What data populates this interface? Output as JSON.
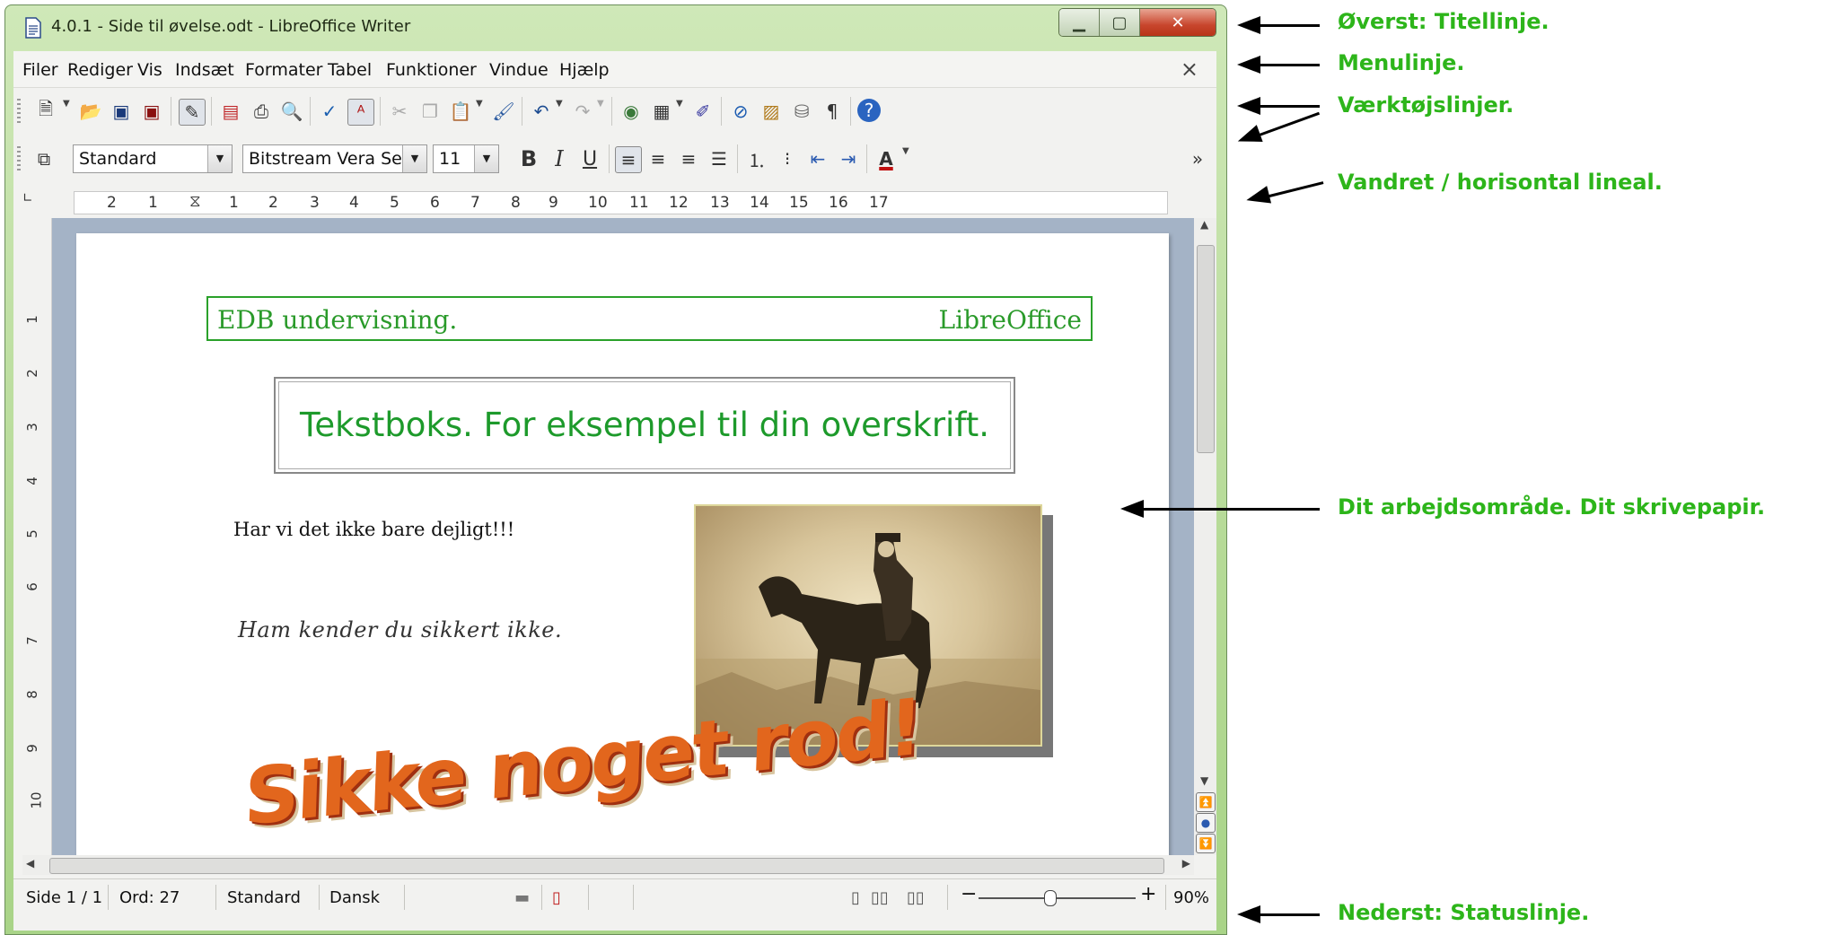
{
  "window": {
    "title": "4.0.1 - Side til øvelse.odt - LibreOffice Writer"
  },
  "menubar": {
    "items": [
      "Filer",
      "Rediger",
      "Vis",
      "Indsæt",
      "Formater",
      "Tabel",
      "Funktioner",
      "Vindue",
      "Hjælp"
    ],
    "close_glyph": "×"
  },
  "toolbar_format": {
    "style": "Standard",
    "font": "Bitstream Vera Serif",
    "size": "11",
    "bold": "B",
    "italic": "I",
    "underline": "U",
    "more": "»"
  },
  "ruler": {
    "numbers": [
      "2",
      "1",
      "1",
      "2",
      "3",
      "4",
      "5",
      "6",
      "7",
      "8",
      "9",
      "10",
      "11",
      "12",
      "13",
      "14",
      "15",
      "16",
      "17"
    ],
    "vertical_numbers": [
      "1",
      "2",
      "3",
      "4",
      "5",
      "6",
      "7",
      "8",
      "9",
      "10"
    ]
  },
  "document": {
    "header_left": "EDB undervisning.",
    "header_right": "LibreOffice",
    "textbox": "Tekstboks. For eksempel til din overskrift.",
    "body_line": "Har vi det ikke bare dejligt!!!",
    "script_line": "Ham kender du sikkert ikke.",
    "wordart": "Sikke noget rod!"
  },
  "statusbar": {
    "page": "Side 1 / 1",
    "words": "Ord: 27",
    "style": "Standard",
    "language": "Dansk",
    "zoom": "90%"
  },
  "annotations": {
    "titlebar": "Øverst: Titellinje.",
    "menubar": "Menulinje.",
    "toolbars": "Værktøjslinjer.",
    "ruler": "Vandret / horisontal lineal.",
    "workarea": "Dit arbejdsområde. Dit skrivepapir.",
    "statusbar": "Nederst: Statuslinje."
  },
  "icons": [
    "document-icon",
    "minimize-icon",
    "maximize-icon",
    "close-icon",
    "new-icon",
    "open-folder-icon",
    "save-icon",
    "save-as-icon",
    "edit-icon",
    "pdf-icon",
    "print-icon",
    "print-preview-icon",
    "spellcheck-icon",
    "autospell-icon",
    "cut-icon",
    "copy-icon",
    "paste-icon",
    "clone-icon",
    "undo-icon",
    "redo-icon",
    "gallery-icon",
    "table-icon",
    "draw-icon",
    "navigator-icon",
    "image-icon",
    "database-icon",
    "pilcrow-icon",
    "help-icon",
    "styles-icon",
    "align-left-icon",
    "align-center-icon",
    "align-right-icon",
    "justify-icon",
    "numbering-icon",
    "bullets-icon",
    "indent-decrease-icon",
    "indent-increase-icon",
    "font-color-icon"
  ]
}
